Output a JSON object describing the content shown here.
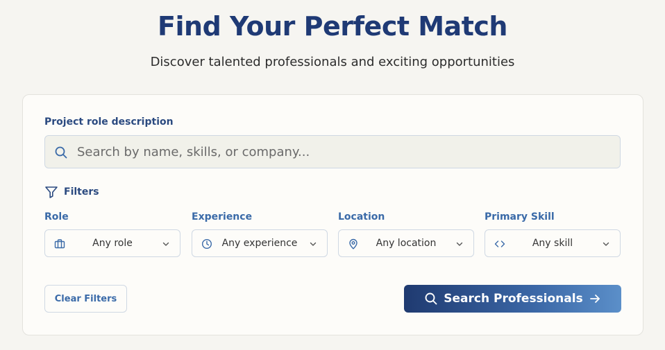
{
  "hero": {
    "title": "Find Your Perfect Match",
    "subtitle": "Discover talented professionals and exciting opportunities"
  },
  "search": {
    "label": "Project role description",
    "placeholder": "Search by name, skills, or company...",
    "value": "",
    "icon": "search-icon"
  },
  "filters": {
    "heading": "Filters",
    "icon": "filter-icon",
    "items": [
      {
        "label": "Role",
        "value": "Any role",
        "icon": "briefcase-icon"
      },
      {
        "label": "Experience",
        "value": "Any experience",
        "icon": "clock-icon"
      },
      {
        "label": "Location",
        "value": "Any location",
        "icon": "map-pin-icon"
      },
      {
        "label": "Primary Skill",
        "value": "Any skill",
        "icon": "code-icon"
      }
    ]
  },
  "actions": {
    "clear_label": "Clear Filters",
    "search_label": "Search Professionals"
  },
  "colors": {
    "background": "#f6f5f1",
    "title": "#1f3a75",
    "accent": "#3a6aa8",
    "button_gradient_start": "#1f3a70",
    "button_gradient_end": "#5b8fc9"
  }
}
